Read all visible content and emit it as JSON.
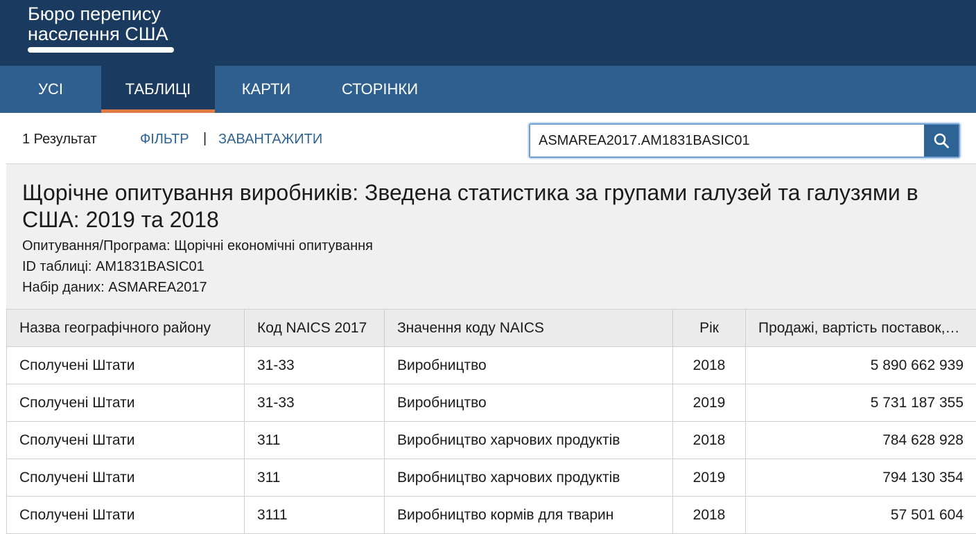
{
  "header": {
    "brand_line1": "Бюро перепису",
    "brand_line2": "населення США"
  },
  "nav": {
    "tabs": [
      {
        "label": "УСІ"
      },
      {
        "label": "ТАБЛИЦІ"
      },
      {
        "label": "КАРТИ"
      },
      {
        "label": "СТОРІНКИ"
      }
    ],
    "active": "ТАБЛИЦІ"
  },
  "toolbar": {
    "result_count": "1 Результат",
    "filter_label": "ФІЛЬТР",
    "separator": "|",
    "download_label": "ЗАВАНТАЖИТИ",
    "search_value": "ASMAREA2017.AM1831BASIC01",
    "search_icon": "search-icon"
  },
  "table_info": {
    "title": "Щорічне опитування виробників: Зведена статистика за групами галузей та галузями в США: 2019 та 2018",
    "survey": "Опитування/Програма: Щорічні економічні опитування",
    "table_id": "ID таблиці: AM1831BASIC01",
    "dataset": "Набір даних: ASMAREA2017"
  },
  "table": {
    "headers": [
      "Назва географічного району",
      "Код NAICS 2017",
      "Значення коду NAICS",
      "Рік",
      "Продажі, вартість поставок, …"
    ],
    "rows": [
      [
        "Сполучені Штати",
        "31-33",
        "Виробництво",
        "2018",
        "5 890 662 939"
      ],
      [
        "Сполучені Штати",
        "31-33",
        "Виробництво",
        "2019",
        "5 731 187 355"
      ],
      [
        "Сполучені Штати",
        "311",
        "Виробництво харчових продуктів",
        "2018",
        "784 628 928"
      ],
      [
        "Сполучені Штати",
        "311",
        "Виробництво харчових продуктів",
        "2019",
        "794 130 354"
      ],
      [
        "Сполучені Штати",
        "3111",
        "Виробництво кормів для тварин",
        "2018",
        "57 501 604"
      ]
    ]
  },
  "colors": {
    "header_bg": "#1a3b5f",
    "nav_bg": "#2e5f8e",
    "active_tab_underline": "#e07b48",
    "link": "#2e6395",
    "search_button": "#2e6395"
  }
}
